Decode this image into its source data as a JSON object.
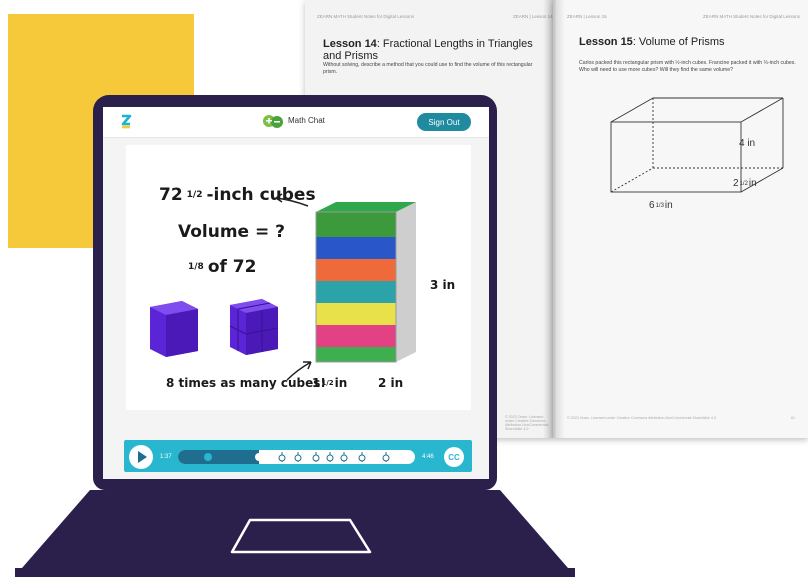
{
  "workbook": {
    "left_page": {
      "header_left": "ZEARN MATH Student Notes for Digital Lessons",
      "header_right": "ZEARN | Lesson 14",
      "title_bold": "Lesson 14",
      "title_rest": ": Fractional Lengths in Triangles and Prisms",
      "body_line1": "Without solving, describe a method that you could use to find the volume of this rectangular",
      "body_line2": "prism.",
      "footer": "© 2023 Zearn. Licensed under Creative Commons Attribution-NonCommercial-ShareAlike 4.0"
    },
    "right_page": {
      "header_left": "ZEARN | Lesson 15",
      "header_right": "ZEARN MATH Student Notes for Digital Lessons",
      "title_bold": "Lesson 15",
      "title_rest": ": Volume of Prisms",
      "body_line1": "Carlos packed this rectangular prism with ½-inch cubes. Francine packed it with ⅓-inch cubes.",
      "body_line2": "Who will need to use more cubes? Will they find the same volume?",
      "dim_height": "4 in",
      "dim_depth": "2",
      "dim_depth_frac": "1/2",
      "dim_depth_unit": "in",
      "dim_length": "6",
      "dim_length_frac": "1/3",
      "dim_length_unit": "in",
      "footer": "© 2023 Zearn. Licensed under Creative Commons Attribution-NonCommercial-ShareAlike 4.0",
      "page_num": "61"
    }
  },
  "app": {
    "chat_label": "Math Chat",
    "signout_label": "Sign Out"
  },
  "lesson_board": {
    "line1_num": "72",
    "line1_frac": "1/2",
    "line1_text": "-inch cubes",
    "line2": "Volume = ?",
    "line3_frac": "1/8",
    "line3_text": "of 72",
    "caption": "8 times as many cubes!",
    "dim_height": "3 in",
    "dim_width": "1",
    "dim_width_frac": "1/2",
    "dim_width_unit": "in",
    "dim_depth": "2 in"
  },
  "player": {
    "elapsed": "1:37",
    "total": "4:46",
    "progress": 0.34,
    "cc_label": "CC",
    "colors": {
      "bar": "#29b6cf",
      "fill": "#1f6e8f"
    }
  },
  "colors": {
    "laptop": "#2b1f4b",
    "accent_yellow": "#f5c93a",
    "signout": "#1f8aa0",
    "cube_purple": "#6a2fe0"
  }
}
